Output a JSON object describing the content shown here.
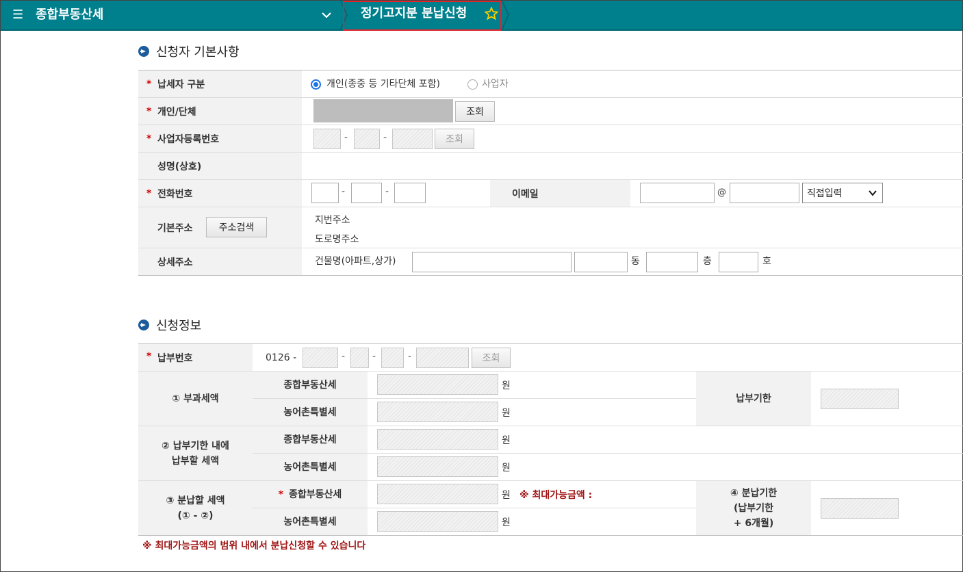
{
  "header": {
    "menu_icon": "hamburger-icon",
    "app_title": "종합부동산세",
    "page_title": "정기고지분 분납신청",
    "bg_color": "#007f8c"
  },
  "section1": {
    "title": "신청자 기본사항",
    "taxpayer_type": {
      "label": "납세자 구분",
      "option1": "개인(종중 등 기타단체 포함)",
      "option2": "사업자",
      "selected": "option1"
    },
    "individual": {
      "label": "개인/단체",
      "lookup": "조회"
    },
    "bizno": {
      "label": "사업자등록번호",
      "lookup": "조회"
    },
    "name": {
      "label": "성명(상호)"
    },
    "phone": {
      "label": "전화번호"
    },
    "email": {
      "label": "이메일",
      "at": "@",
      "select": "직접입력"
    },
    "address": {
      "label": "기본주소",
      "search": "주소검색",
      "lot": "지번주소",
      "road": "도로명주소"
    },
    "detail": {
      "label": "상세주소",
      "building": "건물명(아파트,상가)",
      "dong": "동",
      "floor": "층",
      "ho": "호"
    }
  },
  "section2": {
    "title": "신청정보",
    "payment_no": {
      "label": "납부번호",
      "prefix": "0126 -",
      "lookup": "조회"
    },
    "assessed": {
      "label": "① 부과세액"
    },
    "within_due_l1": "② 납부기한 내에",
    "within_due_l2": "납부할 세액",
    "installment_l1": "③ 분납할 세액",
    "installment_l2": "(① - ②)",
    "comp_tax": "종합부동산세",
    "rural_tax": "농어촌특별세",
    "won": "원",
    "due_date": "납부기한",
    "inst_due_l1": "④ 분납기한",
    "inst_due_l2": "(납부기한",
    "inst_due_l3": "+ 6개월)",
    "max_amount": "※ 최대가능금액 :",
    "footnote": "※ 최대가능금액의 범위 내에서 분납신청할 수 있습니다"
  }
}
